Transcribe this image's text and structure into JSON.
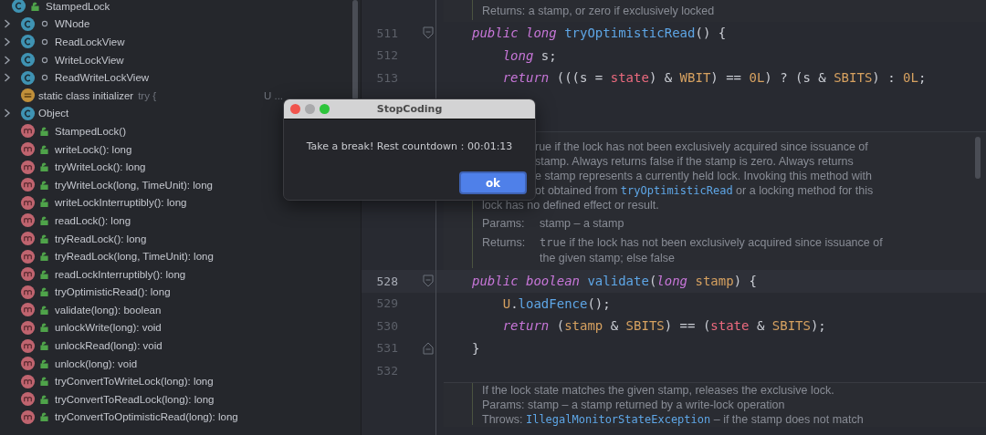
{
  "tree": {
    "label": "StampedLock",
    "kind": "public-class",
    "children": [
      {
        "label": "WNode",
        "kind": "package-class",
        "expanded": false
      },
      {
        "label": "ReadLockView",
        "kind": "package-class",
        "expanded": false
      },
      {
        "label": "WriteLockView",
        "kind": "package-class",
        "expanded": false
      },
      {
        "label": "ReadWriteLockView",
        "kind": "package-class",
        "expanded": false
      },
      {
        "label": "static class initializer",
        "kind": "initializer",
        "hints": [
          "try {",
          "U ..."
        ]
      },
      {
        "label": "Object",
        "kind": "class",
        "expanded": false
      },
      {
        "label": "StampedLock()",
        "kind": "method"
      },
      {
        "label": "writeLock(): long",
        "kind": "method"
      },
      {
        "label": "tryWriteLock(): long",
        "kind": "method"
      },
      {
        "label": "tryWriteLock(long, TimeUnit): long",
        "kind": "method"
      },
      {
        "label": "writeLockInterruptibly(): long",
        "kind": "method"
      },
      {
        "label": "readLock(): long",
        "kind": "method"
      },
      {
        "label": "tryReadLock(): long",
        "kind": "method"
      },
      {
        "label": "tryReadLock(long, TimeUnit): long",
        "kind": "method"
      },
      {
        "label": "readLockInterruptibly(): long",
        "kind": "method"
      },
      {
        "label": "tryOptimisticRead(): long",
        "kind": "method"
      },
      {
        "label": "validate(long): boolean",
        "kind": "method"
      },
      {
        "label": "unlockWrite(long): void",
        "kind": "method"
      },
      {
        "label": "unlockRead(long): void",
        "kind": "method"
      },
      {
        "label": "unlock(long): void",
        "kind": "method"
      },
      {
        "label": "tryConvertToWriteLock(long): long",
        "kind": "method"
      },
      {
        "label": "tryConvertToReadLock(long): long",
        "kind": "method"
      },
      {
        "label": "tryConvertToOptimisticRead(long): long",
        "kind": "method"
      }
    ]
  },
  "editor": [
    {
      "kind": "doc",
      "lines": [
        {
          "kind": "text",
          "segments": [
            {
              "text": "Returns: a stamp, or zero if exclusively locked",
              "kind": "text"
            }
          ]
        }
      ]
    },
    {
      "kind": "open",
      "number": "511",
      "current": false,
      "tokens": [
        {
          "text": "public long ",
          "kind": "keyword"
        },
        {
          "text": "tryOptimisticRead",
          "kind": "function"
        },
        {
          "text": "() {",
          "kind": "plain"
        }
      ]
    },
    {
      "kind": "body",
      "number": "512",
      "current": false,
      "tokens": [
        {
          "text": "long ",
          "kind": "keyword"
        },
        {
          "text": "s;",
          "kind": "plain"
        }
      ]
    },
    {
      "kind": "body",
      "number": "513",
      "current": false,
      "tokens": [
        {
          "text": "return ",
          "kind": "keyword"
        },
        {
          "text": "(((s = ",
          "kind": "plain"
        },
        {
          "text": "state",
          "kind": "field"
        },
        {
          "text": ") & ",
          "kind": "plain"
        },
        {
          "text": "WBIT",
          "kind": "constant"
        },
        {
          "text": ") == ",
          "kind": "plain"
        },
        {
          "text": "0L",
          "kind": "constant"
        },
        {
          "text": ") ? (s & ",
          "kind": "plain"
        },
        {
          "text": "SBITS",
          "kind": "constant"
        },
        {
          "text": ") : ",
          "kind": "plain"
        },
        {
          "text": "0L",
          "kind": "constant"
        },
        {
          "text": ";",
          "kind": "plain"
        }
      ]
    },
    {
      "kind": "hidden"
    },
    {
      "kind": "doc",
      "lines": [
        {
          "kind": "partial",
          "segments": [
            {
              "text": "rue if the lock has not been exclusively acquired since issuance of",
              "kind": "text"
            }
          ]
        },
        {
          "kind": "partial",
          "segments": [
            {
              "text": "stamp. Always returns false if the stamp is zero. Always returns",
              "kind": "text"
            }
          ]
        },
        {
          "kind": "partial",
          "segments": [
            {
              "text": "e stamp represents a currently held lock. Invoking this method with",
              "kind": "text"
            }
          ]
        },
        {
          "kind": "partial",
          "segments": [
            {
              "text": "ot obtained from ",
              "kind": "text"
            },
            {
              "text": "tryOptimisticRead",
              "kind": "link"
            },
            {
              "text": " or a locking method for this",
              "kind": "text"
            }
          ]
        },
        {
          "kind": "text",
          "segments": [
            {
              "text": "lock has no defined effect or result.",
              "kind": "text"
            }
          ]
        },
        {
          "kind": "field",
          "label": "Params:",
          "segments": [
            {
              "text": "stamp – a stamp",
              "kind": "text"
            }
          ]
        },
        {
          "kind": "field",
          "label": "Returns:",
          "segments": [
            {
              "text": "true",
              "kind": "code"
            },
            {
              "text": " if the lock has not been exclusively acquired since issuance of",
              "kind": "text"
            }
          ]
        },
        {
          "kind": "cont",
          "segments": [
            {
              "text": "the given stamp; else false",
              "kind": "text"
            }
          ]
        }
      ]
    },
    {
      "kind": "open",
      "number": "528",
      "current": true,
      "tokens": [
        {
          "text": "public boolean ",
          "kind": "keyword"
        },
        {
          "text": "validate",
          "kind": "function"
        },
        {
          "text": "(",
          "kind": "plain"
        },
        {
          "text": "long ",
          "kind": "keyword"
        },
        {
          "text": "stamp",
          "kind": "constant"
        },
        {
          "text": ") {",
          "kind": "plain"
        }
      ]
    },
    {
      "kind": "body",
      "number": "529",
      "current": false,
      "tokens": [
        {
          "text": "U",
          "kind": "constant"
        },
        {
          "text": ".",
          "kind": "plain"
        },
        {
          "text": "loadFence",
          "kind": "function"
        },
        {
          "text": "();",
          "kind": "plain"
        }
      ]
    },
    {
      "kind": "body",
      "number": "530",
      "current": false,
      "tokens": [
        {
          "text": "return ",
          "kind": "keyword"
        },
        {
          "text": "(",
          "kind": "plain"
        },
        {
          "text": "stamp",
          "kind": "constant"
        },
        {
          "text": " & ",
          "kind": "plain"
        },
        {
          "text": "SBITS",
          "kind": "constant"
        },
        {
          "text": ") == (",
          "kind": "plain"
        },
        {
          "text": "state",
          "kind": "field"
        },
        {
          "text": " & ",
          "kind": "plain"
        },
        {
          "text": "SBITS",
          "kind": "constant"
        },
        {
          "text": ");",
          "kind": "plain"
        }
      ]
    },
    {
      "kind": "close",
      "number": "531",
      "current": false,
      "tokens": [
        {
          "text": "}",
          "kind": "plain"
        }
      ]
    },
    {
      "kind": "blank",
      "number": "532",
      "current": false
    },
    {
      "kind": "doc",
      "lines": [
        {
          "kind": "text",
          "segments": [
            {
              "text": "If the lock state matches the given stamp, releases the exclusive lock.",
              "kind": "text"
            }
          ]
        },
        {
          "kind": "text",
          "segments": [
            {
              "text": "Params: stamp – a stamp returned by a write-lock operation",
              "kind": "text"
            }
          ]
        },
        {
          "kind": "text",
          "segments": [
            {
              "text": "Throws: ",
              "kind": "text"
            },
            {
              "text": "IllegalMonitorStateException",
              "kind": "link"
            },
            {
              "text": " – if the stamp does not match",
              "kind": "text"
            }
          ]
        }
      ]
    }
  ],
  "dialog": {
    "title": "StopCoding",
    "message": "Take a break! Rest countdown：00:01:13",
    "button": "ok"
  }
}
